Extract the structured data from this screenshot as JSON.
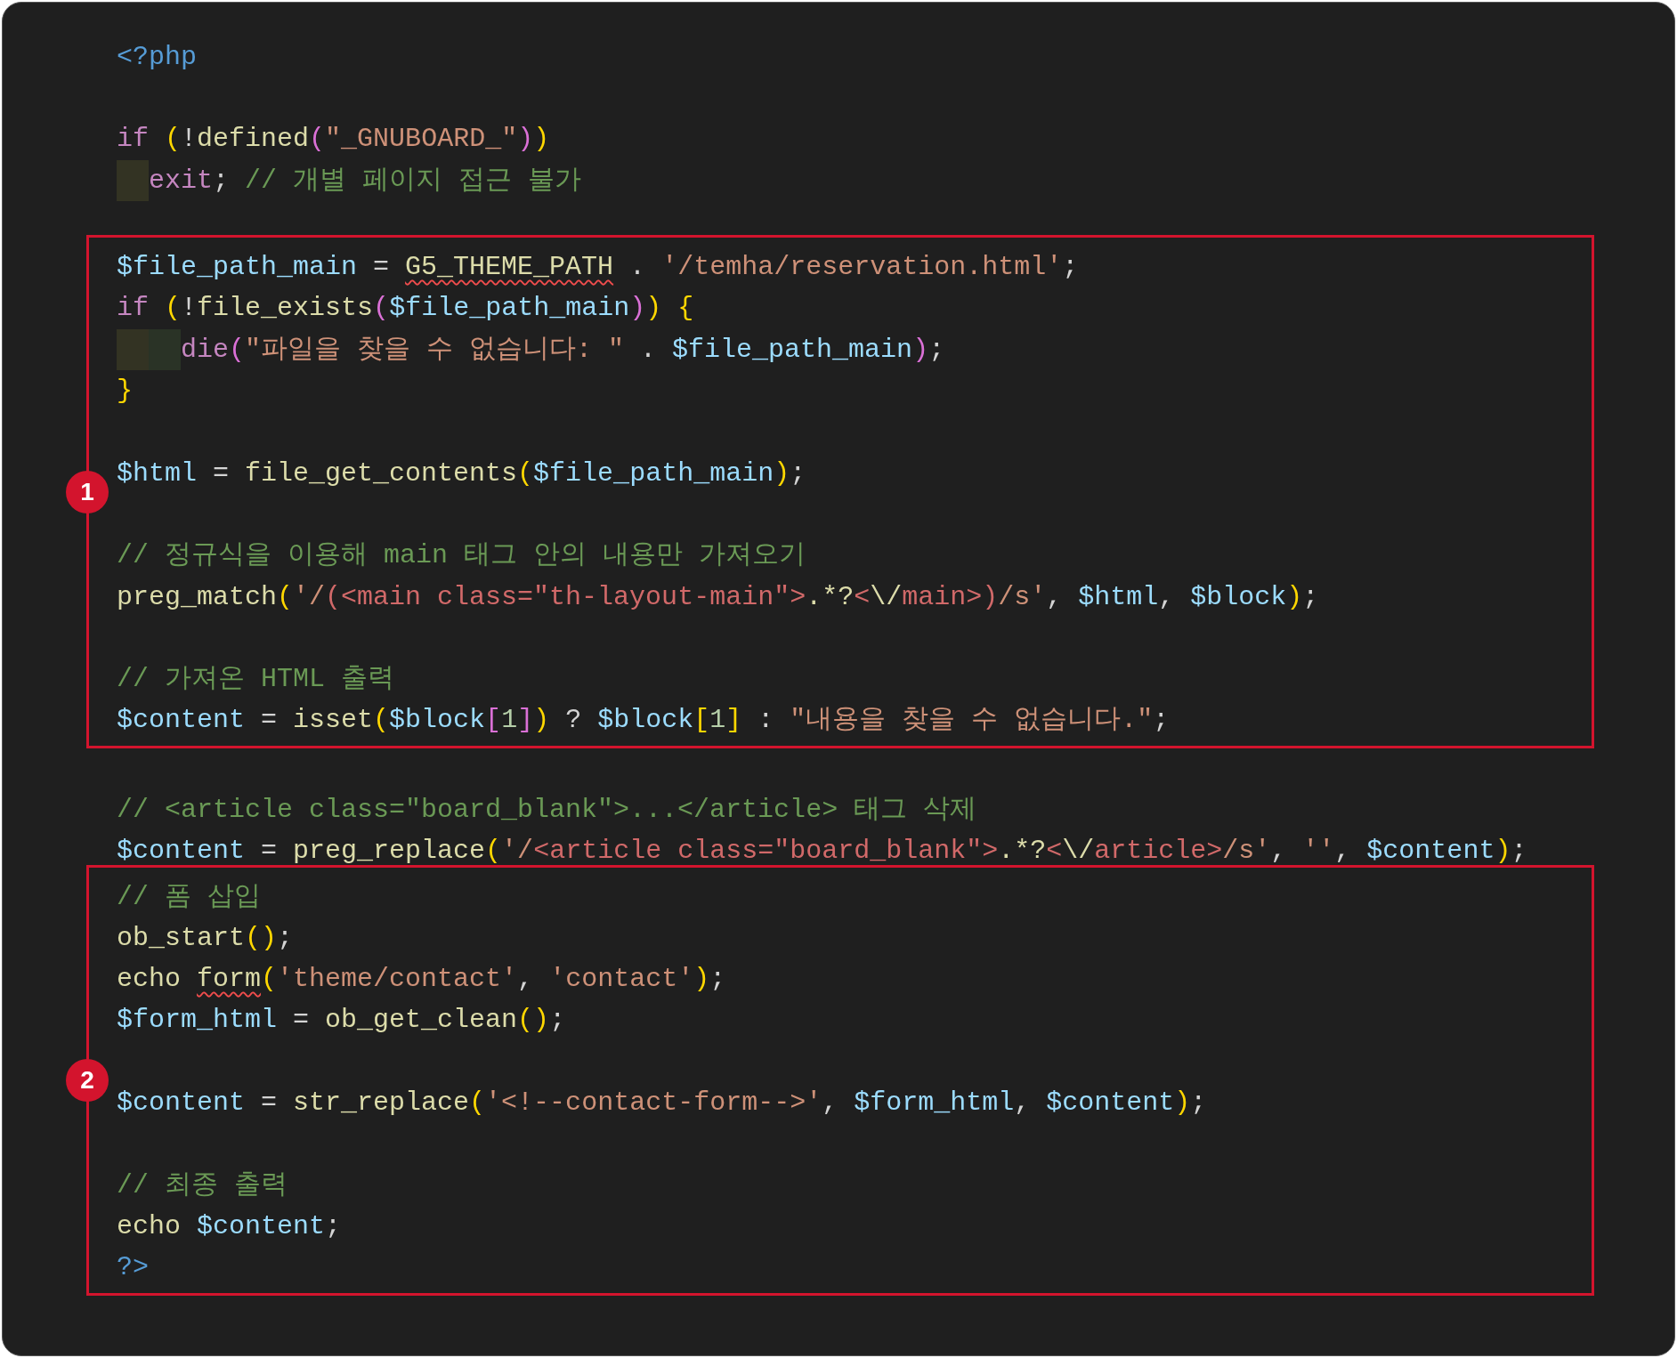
{
  "sections": [
    {
      "kind": "plain",
      "lines": [
        {
          "kind": "code",
          "tokens": [
            {
              "kind": "tag",
              "text": "<?php"
            }
          ]
        },
        {
          "kind": "blank"
        },
        {
          "kind": "code",
          "tokens": [
            {
              "kind": "keyword",
              "text": "if"
            },
            {
              "kind": "space"
            },
            {
              "kind": "bracket",
              "color": "#ffd700",
              "text": "("
            },
            {
              "kind": "punct",
              "text": "!"
            },
            {
              "kind": "func",
              "text": "defined"
            },
            {
              "kind": "bracket",
              "color": "#da70d6",
              "text": "("
            },
            {
              "kind": "str",
              "text": "\"_GNUBOARD_\""
            },
            {
              "kind": "bracket",
              "color": "#da70d6",
              "text": ")"
            },
            {
              "kind": "bracket",
              "color": "#ffd700",
              "text": ")"
            }
          ]
        },
        {
          "kind": "code",
          "tokens": [
            {
              "kind": "indent_guide",
              "color": "#333323"
            },
            {
              "kind": "keyword",
              "text": "exit"
            },
            {
              "kind": "punct",
              "text": "; "
            },
            {
              "kind": "comment",
              "text": "// 개별 페이지 접근 불가"
            }
          ]
        },
        {
          "kind": "blank"
        }
      ]
    },
    {
      "kind": "highlight",
      "badge": "1",
      "lines": [
        {
          "kind": "code",
          "tokens": [
            {
              "kind": "var",
              "text": "$file_path_main"
            },
            {
              "kind": "punct",
              "text": " = "
            },
            {
              "kind": "func",
              "text": "G5_THEME_PATH",
              "squiggle": true
            },
            {
              "kind": "punct",
              "text": " . "
            },
            {
              "kind": "str",
              "text": "'/temha/reservation.html'"
            },
            {
              "kind": "punct",
              "text": ";"
            }
          ]
        },
        {
          "kind": "code",
          "tokens": [
            {
              "kind": "keyword",
              "text": "if"
            },
            {
              "kind": "space"
            },
            {
              "kind": "bracket",
              "color": "#ffd700",
              "text": "("
            },
            {
              "kind": "punct",
              "text": "!"
            },
            {
              "kind": "func",
              "text": "file_exists"
            },
            {
              "kind": "bracket",
              "color": "#da70d6",
              "text": "("
            },
            {
              "kind": "var",
              "text": "$file_path_main"
            },
            {
              "kind": "bracket",
              "color": "#da70d6",
              "text": ")"
            },
            {
              "kind": "bracket",
              "color": "#ffd700",
              "text": ")"
            },
            {
              "kind": "space"
            },
            {
              "kind": "bracket",
              "color": "#ffd700",
              "text": "{"
            }
          ]
        },
        {
          "kind": "code",
          "tokens": [
            {
              "kind": "indent_guide",
              "color": "#333323"
            },
            {
              "kind": "indent_guide",
              "color": "#2a3326"
            },
            {
              "kind": "keyword",
              "text": "die"
            },
            {
              "kind": "bracket",
              "color": "#da70d6",
              "text": "("
            },
            {
              "kind": "str",
              "text": "\"파일을 찾을 수 없습니다: \""
            },
            {
              "kind": "punct",
              "text": " . "
            },
            {
              "kind": "var",
              "text": "$file_path_main"
            },
            {
              "kind": "bracket",
              "color": "#da70d6",
              "text": ")"
            },
            {
              "kind": "punct",
              "text": ";"
            }
          ]
        },
        {
          "kind": "code",
          "tokens": [
            {
              "kind": "bracket",
              "color": "#ffd700",
              "text": "}"
            }
          ]
        },
        {
          "kind": "blank"
        },
        {
          "kind": "code",
          "tokens": [
            {
              "kind": "var",
              "text": "$html"
            },
            {
              "kind": "punct",
              "text": " = "
            },
            {
              "kind": "func",
              "text": "file_get_contents"
            },
            {
              "kind": "bracket",
              "color": "#ffd700",
              "text": "("
            },
            {
              "kind": "var",
              "text": "$file_path_main"
            },
            {
              "kind": "bracket",
              "color": "#ffd700",
              "text": ")"
            },
            {
              "kind": "punct",
              "text": ";"
            }
          ]
        },
        {
          "kind": "blank"
        },
        {
          "kind": "code",
          "tokens": [
            {
              "kind": "comment",
              "text": "// 정규식을 이용해 main 태그 안의 내용만 가져오기"
            }
          ]
        },
        {
          "kind": "code",
          "tokens": [
            {
              "kind": "func",
              "text": "preg_match"
            },
            {
              "kind": "bracket",
              "color": "#ffd700",
              "text": "("
            },
            {
              "kind": "str",
              "text": "'/"
            },
            {
              "kind": "regex",
              "text": "(<main class=\"th-layout-main\">"
            },
            {
              "kind": "func",
              "text": ".*?"
            },
            {
              "kind": "regex",
              "text": "<"
            },
            {
              "kind": "func",
              "text": "\\/"
            },
            {
              "kind": "regex",
              "text": "main>)"
            },
            {
              "kind": "str",
              "text": "/s'"
            },
            {
              "kind": "punct",
              "text": ", "
            },
            {
              "kind": "var",
              "text": "$html"
            },
            {
              "kind": "punct",
              "text": ", "
            },
            {
              "kind": "var",
              "text": "$block"
            },
            {
              "kind": "bracket",
              "color": "#ffd700",
              "text": ")"
            },
            {
              "kind": "punct",
              "text": ";"
            }
          ]
        },
        {
          "kind": "blank"
        },
        {
          "kind": "code",
          "tokens": [
            {
              "kind": "comment",
              "text": "// 가져온 HTML 출력"
            }
          ]
        },
        {
          "kind": "code",
          "tokens": [
            {
              "kind": "var",
              "text": "$content"
            },
            {
              "kind": "punct",
              "text": " = "
            },
            {
              "kind": "func",
              "text": "isset"
            },
            {
              "kind": "bracket",
              "color": "#ffd700",
              "text": "("
            },
            {
              "kind": "var",
              "text": "$block"
            },
            {
              "kind": "bracket",
              "color": "#da70d6",
              "text": "["
            },
            {
              "kind": "num",
              "text": "1"
            },
            {
              "kind": "bracket",
              "color": "#da70d6",
              "text": "]"
            },
            {
              "kind": "bracket",
              "color": "#ffd700",
              "text": ")"
            },
            {
              "kind": "punct",
              "text": " ? "
            },
            {
              "kind": "var",
              "text": "$block"
            },
            {
              "kind": "bracket",
              "color": "#ffd700",
              "text": "["
            },
            {
              "kind": "num",
              "text": "1"
            },
            {
              "kind": "bracket",
              "color": "#ffd700",
              "text": "]"
            },
            {
              "kind": "punct",
              "text": " : "
            },
            {
              "kind": "str",
              "text": "\"내용을 찾을 수 없습니다.\""
            },
            {
              "kind": "punct",
              "text": ";"
            }
          ]
        }
      ]
    },
    {
      "kind": "plain",
      "lines": [
        {
          "kind": "blank"
        },
        {
          "kind": "code",
          "tokens": [
            {
              "kind": "comment",
              "text": "// <article class=\"board_blank\">...</article> 태그 삭제"
            }
          ]
        },
        {
          "kind": "code",
          "tokens": [
            {
              "kind": "var",
              "text": "$content"
            },
            {
              "kind": "punct",
              "text": " = "
            },
            {
              "kind": "func",
              "text": "preg_replace"
            },
            {
              "kind": "bracket",
              "color": "#ffd700",
              "text": "("
            },
            {
              "kind": "str",
              "text": "'/"
            },
            {
              "kind": "regex",
              "text": "<article class=\"board_blank\">"
            },
            {
              "kind": "func",
              "text": ".*?"
            },
            {
              "kind": "regex",
              "text": "<"
            },
            {
              "kind": "func",
              "text": "\\/"
            },
            {
              "kind": "regex",
              "text": "article>"
            },
            {
              "kind": "str",
              "text": "/s'"
            },
            {
              "kind": "punct",
              "text": ", "
            },
            {
              "kind": "str",
              "text": "''"
            },
            {
              "kind": "punct",
              "text": ", "
            },
            {
              "kind": "var",
              "text": "$content"
            },
            {
              "kind": "bracket",
              "color": "#ffd700",
              "text": ")"
            },
            {
              "kind": "punct",
              "text": ";"
            }
          ]
        }
      ]
    },
    {
      "kind": "highlight",
      "badge": "2",
      "lines": [
        {
          "kind": "code",
          "tokens": [
            {
              "kind": "comment",
              "text": "// 폼 삽입"
            }
          ]
        },
        {
          "kind": "code",
          "tokens": [
            {
              "kind": "func",
              "text": "ob_start"
            },
            {
              "kind": "bracket",
              "color": "#ffd700",
              "text": "("
            },
            {
              "kind": "bracket",
              "color": "#ffd700",
              "text": ")"
            },
            {
              "kind": "punct",
              "text": ";"
            }
          ]
        },
        {
          "kind": "code",
          "tokens": [
            {
              "kind": "func",
              "text": "echo"
            },
            {
              "kind": "space"
            },
            {
              "kind": "func",
              "text": "form",
              "squiggle": true
            },
            {
              "kind": "bracket",
              "color": "#ffd700",
              "text": "("
            },
            {
              "kind": "str",
              "text": "'theme/contact'"
            },
            {
              "kind": "punct",
              "text": ", "
            },
            {
              "kind": "str",
              "text": "'contact'"
            },
            {
              "kind": "bracket",
              "color": "#ffd700",
              "text": ")"
            },
            {
              "kind": "punct",
              "text": ";"
            }
          ]
        },
        {
          "kind": "code",
          "tokens": [
            {
              "kind": "var",
              "text": "$form_html"
            },
            {
              "kind": "punct",
              "text": " = "
            },
            {
              "kind": "func",
              "text": "ob_get_clean"
            },
            {
              "kind": "bracket",
              "color": "#ffd700",
              "text": "("
            },
            {
              "kind": "bracket",
              "color": "#ffd700",
              "text": ")"
            },
            {
              "kind": "punct",
              "text": ";"
            }
          ]
        },
        {
          "kind": "blank"
        },
        {
          "kind": "code",
          "tokens": [
            {
              "kind": "var",
              "text": "$content"
            },
            {
              "kind": "punct",
              "text": " = "
            },
            {
              "kind": "func",
              "text": "str_replace"
            },
            {
              "kind": "bracket",
              "color": "#ffd700",
              "text": "("
            },
            {
              "kind": "str",
              "text": "'<!--contact-form-->'"
            },
            {
              "kind": "punct",
              "text": ", "
            },
            {
              "kind": "var",
              "text": "$form_html"
            },
            {
              "kind": "punct",
              "text": ", "
            },
            {
              "kind": "var",
              "text": "$content"
            },
            {
              "kind": "bracket",
              "color": "#ffd700",
              "text": ")"
            },
            {
              "kind": "punct",
              "text": ";"
            }
          ]
        },
        {
          "kind": "blank"
        },
        {
          "kind": "code",
          "tokens": [
            {
              "kind": "comment",
              "text": "// 최종 출력"
            }
          ]
        },
        {
          "kind": "code",
          "tokens": [
            {
              "kind": "func",
              "text": "echo"
            },
            {
              "kind": "space"
            },
            {
              "kind": "var",
              "text": "$content"
            },
            {
              "kind": "punct",
              "text": ";"
            }
          ]
        },
        {
          "kind": "code",
          "tokens": [
            {
              "kind": "tag",
              "text": "?>"
            }
          ]
        }
      ]
    }
  ]
}
